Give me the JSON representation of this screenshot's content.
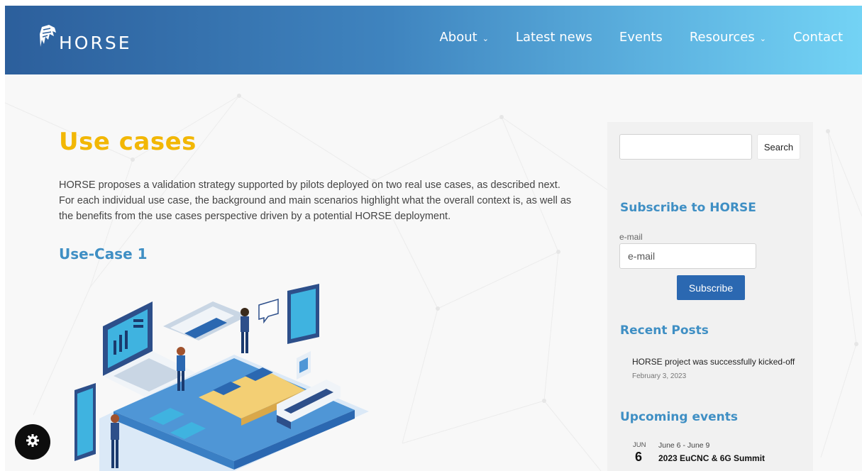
{
  "header": {
    "logo_text": "HORSE",
    "nav": [
      {
        "label": "About",
        "dropdown": true
      },
      {
        "label": "Latest news",
        "dropdown": false
      },
      {
        "label": "Events",
        "dropdown": false
      },
      {
        "label": "Resources",
        "dropdown": true
      },
      {
        "label": "Contact",
        "dropdown": false
      }
    ]
  },
  "main": {
    "title": "Use cases",
    "intro": "HORSE proposes a validation strategy supported by pilots deployed on two real use cases, as described next. For each individual use case, the background and main scenarios highlight what the overall context is, as well as the benefits from the use cases perspective driven by a potential HORSE deployment.",
    "usecase_heading": "Use-Case 1"
  },
  "sidebar": {
    "search": {
      "value": "",
      "placeholder": "",
      "button_label": "Search"
    },
    "subscribe": {
      "heading": "Subscribe to HORSE",
      "email_label": "e-mail",
      "email_placeholder": "e-mail",
      "button_label": "Subscribe"
    },
    "recent_posts": {
      "heading": "Recent Posts",
      "items": [
        {
          "title": "HORSE project was successfully kicked-off",
          "date": "February 3, 2023"
        }
      ]
    },
    "upcoming_events": {
      "heading": "Upcoming events",
      "items": [
        {
          "month": "JUN",
          "day": "6",
          "range": "June 6 - June 9",
          "title": "2023 EuCNC & 6G Summit"
        }
      ]
    }
  },
  "colors": {
    "title_yellow": "#f2b705",
    "heading_blue": "#3f8fc4",
    "button_blue": "#2b68b1",
    "header_gradient_start": "#2c5f9c",
    "header_gradient_end": "#73d3f5"
  },
  "icons": {
    "logo": "horse-head-logo-icon",
    "chevron": "chevron-down-icon",
    "gear": "gear-icon"
  }
}
